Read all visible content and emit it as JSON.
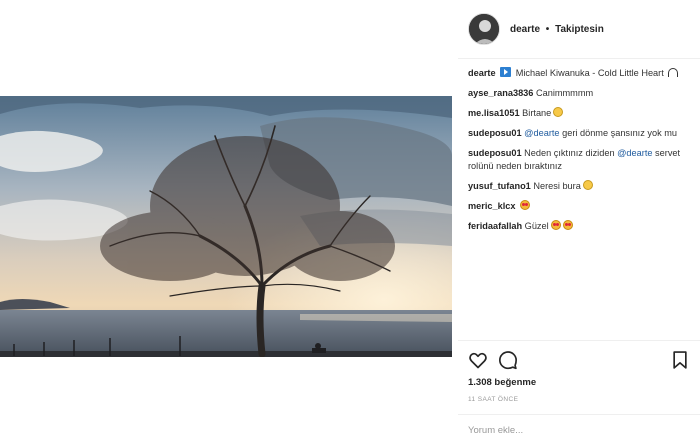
{
  "header": {
    "username": "dearte",
    "separator": "•",
    "follow_status": "Takiptesin"
  },
  "caption": {
    "user": "dearte",
    "text": " Michael Kiwanuka - Cold Little Heart"
  },
  "comments": [
    {
      "user": "ayse_rana3836",
      "text": " Canimmmmm"
    },
    {
      "user": "me.lisa1051",
      "text": " Birtane"
    },
    {
      "user": "sudeposu01",
      "mention": " @dearte",
      "text": " geri dönme şansınız yok mu"
    },
    {
      "user": "sudeposu01",
      "text_before": " Neden çıktınız diziden ",
      "mention": "@dearte",
      "text": " servet rolünü neden bıraktınız"
    },
    {
      "user": "yusuf_tufano1",
      "text": " Neresi bura"
    },
    {
      "user": "meric_klcx",
      "text": ""
    },
    {
      "user": "feridaafallah",
      "text": " Güzel"
    }
  ],
  "likes_text": "1.308 beğenme",
  "time_text": "11 SAAT ÖNCE",
  "comment_input": {
    "placeholder": "Yorum ekle..."
  },
  "icons": {
    "like": "heart-icon",
    "comment": "comment-bubble-icon",
    "save": "bookmark-icon",
    "caption_badge": "play-icon",
    "caption_emoji": "headphones-icon"
  },
  "colors": {
    "text": "#262626",
    "mention": "#1f5b9e",
    "muted": "#999999",
    "divider": "#efefef"
  }
}
